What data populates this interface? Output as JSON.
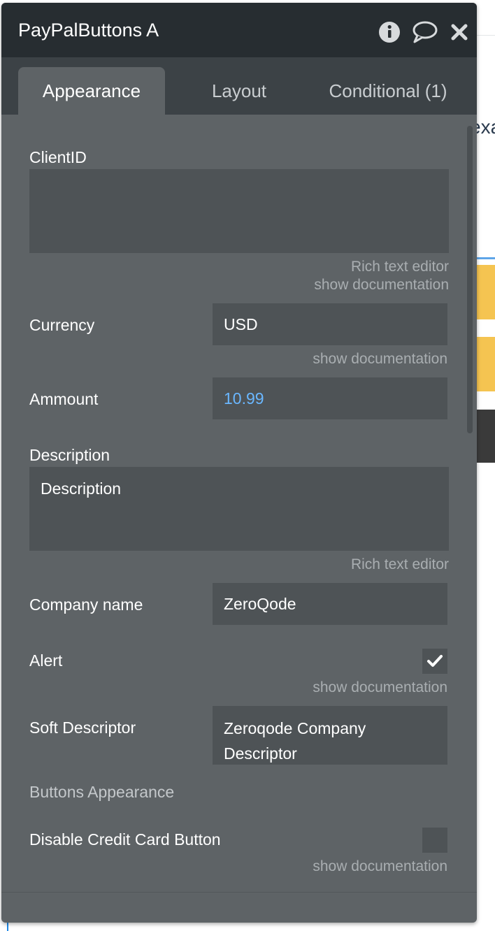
{
  "background": {
    "partial_text": "exa",
    "accent_colors": [
      "#f5c451",
      "#3a3a3a"
    ]
  },
  "panel": {
    "title": "PayPalButtons A",
    "icons": [
      "info-icon",
      "comment-icon",
      "close-icon"
    ]
  },
  "tabs": [
    {
      "label": "Appearance",
      "active": true
    },
    {
      "label": "Layout",
      "active": false
    },
    {
      "label": "Conditional (1)",
      "active": false
    }
  ],
  "fields": {
    "client_id": {
      "label": "ClientID",
      "value": "",
      "helper_rich": "Rich text editor",
      "helper_doc": "show documentation"
    },
    "currency": {
      "label": "Currency",
      "value": "USD",
      "helper_doc": "show documentation"
    },
    "amount": {
      "label": "Ammount",
      "value": "10.99"
    },
    "description": {
      "label": "Description",
      "value": "Description",
      "helper_rich": "Rich text editor"
    },
    "company_name": {
      "label": "Company name",
      "value": "ZeroQode"
    },
    "alert": {
      "label": "Alert",
      "checked": true,
      "helper_doc": "show documentation"
    },
    "soft_descriptor": {
      "label": "Soft Descriptor",
      "value_line1": "Zeroqode Company",
      "value_line2": "Descriptor"
    }
  },
  "section": {
    "buttons_appearance": "Buttons Appearance"
  },
  "disable_credit_card": {
    "label": "Disable Credit Card Button",
    "checked": false,
    "helper_doc": "show documentation"
  },
  "colors": {
    "titlebar": "#272d31",
    "tabbar": "#3c4246",
    "panel": "#5e6366",
    "field": "#4e5356",
    "dynamic_value": "#6ab7ff"
  }
}
